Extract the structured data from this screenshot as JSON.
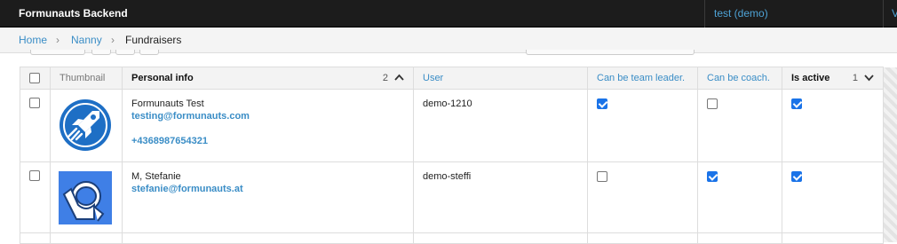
{
  "topbar": {
    "brand": "Formunauts Backend",
    "user": "test (demo)",
    "more": "V"
  },
  "breadcrumb": {
    "items": [
      "Home",
      "Nanny"
    ],
    "current": "Fundraisers",
    "separator": "›"
  },
  "table": {
    "columns": {
      "thumbnail": "Thumbnail",
      "personal_info": "Personal info",
      "personal_info_sort": "2",
      "user": "User",
      "team_leader": "Can be team leader.",
      "coach": "Can be coach.",
      "active": "Is active",
      "active_sort": "1"
    },
    "rows": [
      {
        "name": "Formunauts Test",
        "email": "testing@formunauts.com",
        "phone": "+4368987654321",
        "user": "demo-1210",
        "team_leader": true,
        "coach": false,
        "active": true,
        "thumbnail": "rocket-icon"
      },
      {
        "name": "M, Stefanie",
        "email": "stefanie@formunauts.at",
        "phone": "",
        "user": "demo-steffi",
        "team_leader": false,
        "coach": true,
        "active": true,
        "thumbnail": "astronaut-icon"
      }
    ]
  },
  "colors": {
    "accent": "#3a8dc6",
    "checkbox": "#1a73e8",
    "topbar": "#1c1c1c",
    "thumb_bg": "#1e6fc5"
  }
}
